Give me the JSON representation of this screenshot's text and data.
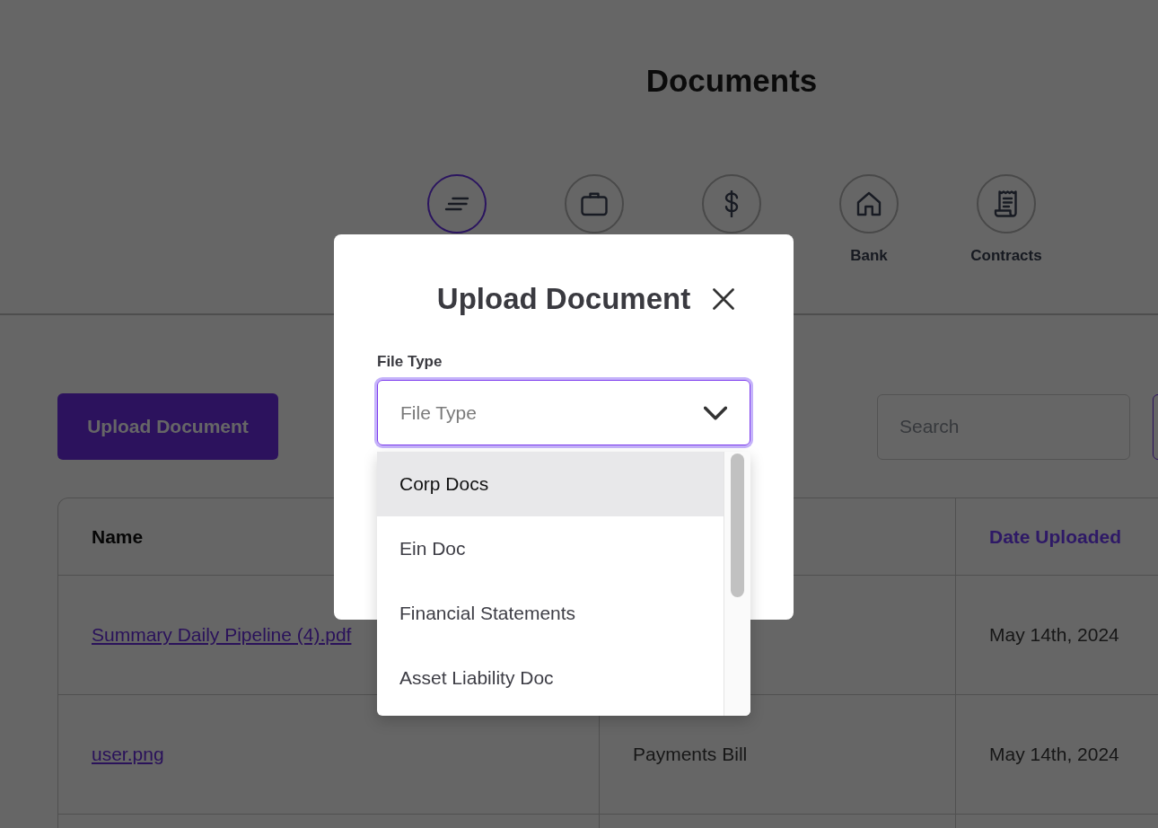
{
  "page": {
    "title": "Documents"
  },
  "categories": [
    {
      "kind": "lines",
      "selected": true
    },
    {
      "kind": "briefcase",
      "selected": false
    },
    {
      "kind": "dollar",
      "selected": false
    },
    {
      "kind": "house",
      "label": "Bank",
      "selected": false
    },
    {
      "kind": "receipt",
      "label": "Contracts",
      "selected": false
    }
  ],
  "toolbar": {
    "upload_button": "Upload Document",
    "search": {
      "placeholder": "Search"
    }
  },
  "table": {
    "columns": [
      {
        "label": "Name",
        "sorted": false
      },
      null,
      {
        "label": "Date Uploaded",
        "sorted": true
      }
    ],
    "rows": [
      {
        "name": "Summary Daily Pipeline (4).pdf",
        "date_uploaded": "May 14th, 2024"
      },
      {
        "name": "user.png",
        "column_2": "Payments Bill",
        "date_uploaded": "May 14th, 2024"
      }
    ]
  },
  "modal": {
    "title": "Upload Document",
    "field": {
      "label": "File Type",
      "placeholder": "File Type",
      "expanded": true
    },
    "options": [
      {
        "label": "Corp Docs",
        "highlighted": true
      },
      {
        "label": "Ein Doc",
        "highlighted": false
      },
      {
        "label": "Financial Statements",
        "highlighted": false
      },
      {
        "label": "Asset Liability Doc",
        "highlighted": false
      }
    ]
  }
}
